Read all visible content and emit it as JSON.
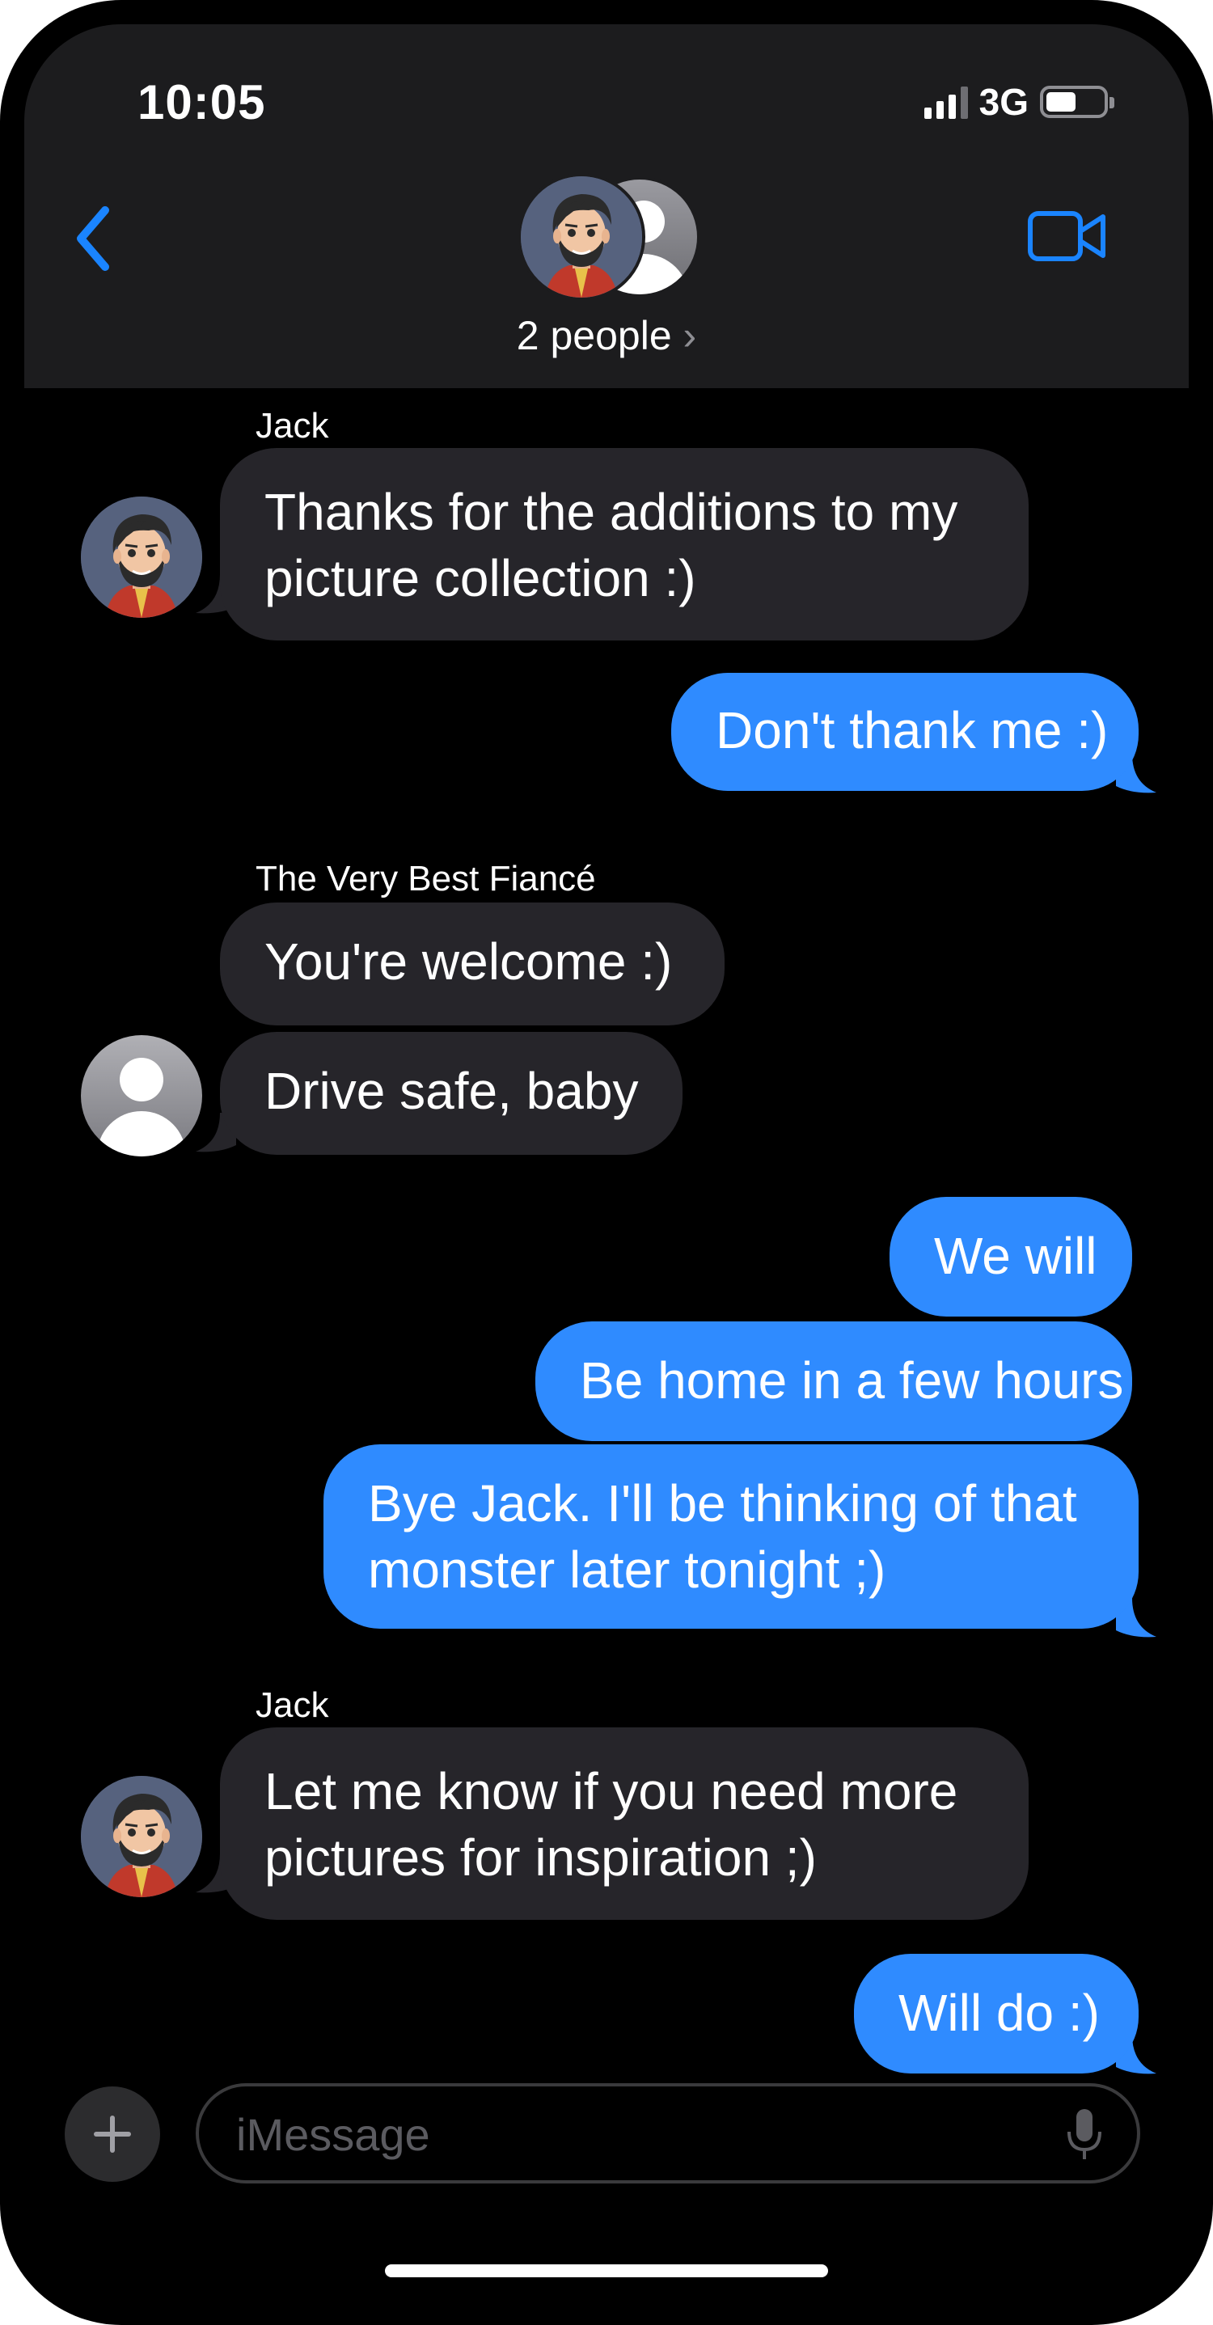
{
  "status_bar": {
    "time": "10:05",
    "network": "3G"
  },
  "header": {
    "title": "2 people",
    "title_chevron": "›"
  },
  "messages": [
    {
      "sender": "Jack",
      "direction": "in",
      "lines": [
        "Thanks for the additions to my",
        "picture collection :)"
      ]
    },
    {
      "direction": "out",
      "lines": [
        "Don't thank me :)"
      ]
    },
    {
      "sender": "The Very Best Fiancé",
      "direction": "in",
      "lines": [
        "You're welcome :)"
      ]
    },
    {
      "direction": "in",
      "lines": [
        "Drive safe, baby"
      ]
    },
    {
      "direction": "out",
      "lines": [
        "We will"
      ]
    },
    {
      "direction": "out",
      "lines": [
        "Be home in a few hours"
      ]
    },
    {
      "direction": "out",
      "lines": [
        "Bye Jack.  I'll be thinking of that",
        "monster later tonight ;)"
      ]
    },
    {
      "sender": "Jack",
      "direction": "in",
      "lines": [
        "Let me know if you need more",
        "pictures for inspiration ;)"
      ]
    },
    {
      "direction": "out",
      "lines": [
        "Will do :)"
      ]
    }
  ],
  "composer": {
    "placeholder": "iMessage",
    "value": ""
  },
  "colors": {
    "incoming_bubble": "#26252a",
    "outgoing_bubble": "#2f8bff",
    "accent": "#1a84ff",
    "header_bg": "#1c1c1e"
  },
  "icons": [
    "back-chevron-icon",
    "video-camera-icon",
    "plus-icon",
    "microphone-icon",
    "signal-icon",
    "battery-icon"
  ]
}
